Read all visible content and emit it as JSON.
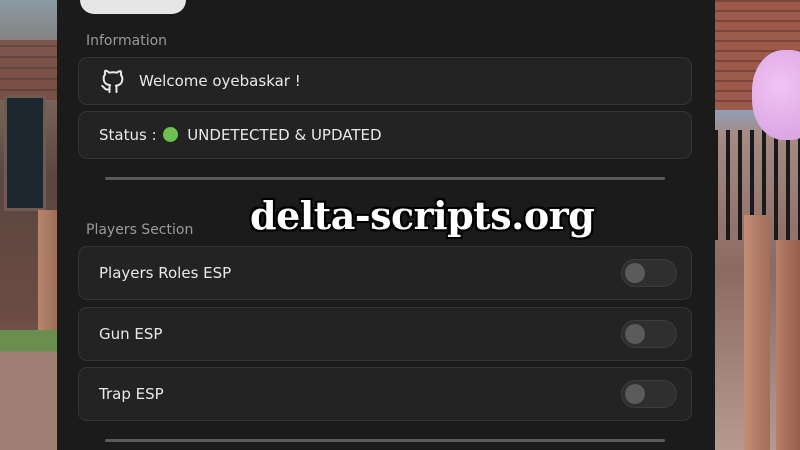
{
  "information": {
    "section_label": "Information",
    "welcome_text": "Welcome oyebaskar !",
    "welcome_icon": "github-icon",
    "status_prefix": "Status :",
    "status_value": "UNDETECTED & UPDATED",
    "status_color": "#6cc14f"
  },
  "players_section": {
    "section_label": "Players Section",
    "toggles": [
      {
        "label": "Players Roles ESP",
        "enabled": false
      },
      {
        "label": "Gun ESP",
        "enabled": false
      },
      {
        "label": "Trap ESP",
        "enabled": false
      }
    ]
  },
  "watermark": "delta-scripts.org",
  "colors": {
    "panel_bg": "#1b1b1b",
    "card_bg": "#232323",
    "text": "#e9e9e9",
    "section_label": "#9a9a9a"
  }
}
